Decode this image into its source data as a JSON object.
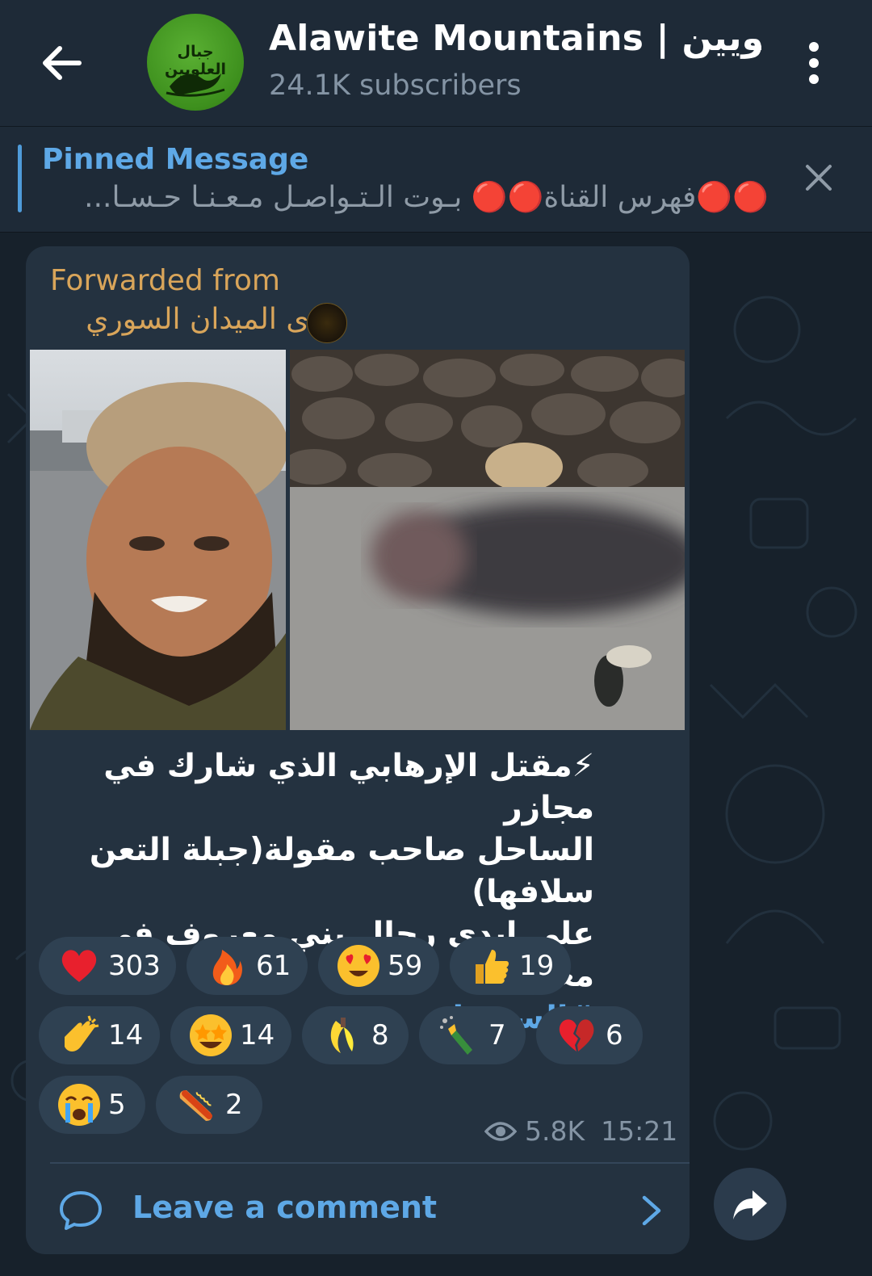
{
  "header": {
    "title": "Alawite Mountains | العلويين",
    "subtitle": "24.1K subscribers",
    "avatar_text": "جبال العلويين"
  },
  "pinned": {
    "title": "Pinned Message",
    "text": "🔴🔴فهرس القناة🔴🔴 بـوت الـتـواصـل مـعـنـا حـسـا..."
  },
  "message": {
    "forwarded_label": "Forwarded from",
    "forwarded_channel": "صدى الميدان السوري",
    "caption_lines": [
      "⚡مقتل الإرهابي الذي شارك في مجازر",
      "الساحل صاحب مقولة(جبلة التعن سلافها)",
      "على ايدي رجال بني معروف في معارك"
    ],
    "hashtag": "#السويداء",
    "views": "5.8K",
    "time": "15:21",
    "comment_label": "Leave a comment"
  },
  "reactions": [
    {
      "emoji": "heart-icon",
      "count": "303"
    },
    {
      "emoji": "fire-icon",
      "count": "61"
    },
    {
      "emoji": "heart-eyes-icon",
      "count": "59"
    },
    {
      "emoji": "thumbs-up-icon",
      "count": "19"
    },
    {
      "emoji": "clap-icon",
      "count": "14"
    },
    {
      "emoji": "star-struck-icon",
      "count": "14"
    },
    {
      "emoji": "banana-icon",
      "count": "8"
    },
    {
      "emoji": "champagne-icon",
      "count": "7"
    },
    {
      "emoji": "broken-heart-icon",
      "count": "6"
    },
    {
      "emoji": "crying-icon",
      "count": "5"
    },
    {
      "emoji": "hotdog-icon",
      "count": "2"
    }
  ],
  "colors": {
    "background": "#17212b",
    "header": "#1e2a37",
    "bubble": "#243240",
    "accent": "#5ea8e6",
    "forwarded": "#d9a55a",
    "reaction_pill": "#2f4152"
  }
}
